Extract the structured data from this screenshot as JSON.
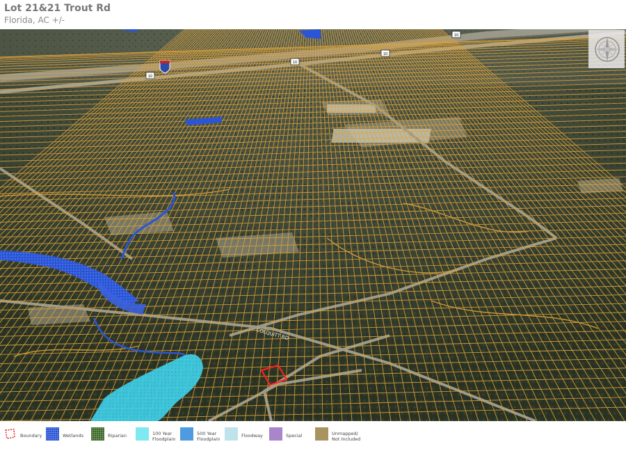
{
  "header": {
    "title": "Lot 21&21 Trout Rd",
    "subtitle": "Florida,  AC +/-"
  },
  "map": {
    "highway_shields": [
      "10",
      "10",
      "10",
      "10"
    ],
    "road_labels": [
      "COLQUITT RD"
    ],
    "colors": {
      "parcel_lines": "#e0a43a",
      "subject_boundary": "#ff2020",
      "wetlands": "#2a55d6",
      "floodplain": "#3fd0e8",
      "forest": "#2f3a28"
    }
  },
  "compass": {
    "icon": "compass-rose-icon"
  },
  "legend": {
    "items": [
      {
        "key": "boundary",
        "label": "Boundary",
        "color": "#d03030"
      },
      {
        "key": "wetlands",
        "label": "Wetlands",
        "color": "#2a55d6"
      },
      {
        "key": "riparian",
        "label": "Riparian",
        "color": "#3d6b2a"
      },
      {
        "key": "floodplain-100",
        "label": "100 Year\nFloodplain",
        "color": "#7ee9f0"
      },
      {
        "key": "floodplain-500",
        "label": "500 Year\nFloodplain",
        "color": "#4f9be0"
      },
      {
        "key": "floodway",
        "label": "Floodway",
        "color": "#bfe3ea"
      },
      {
        "key": "special",
        "label": "Special",
        "color": "#a985c9"
      },
      {
        "key": "unmapped",
        "label": "Unmapped/\nNot Included",
        "color": "#a99461"
      }
    ]
  }
}
